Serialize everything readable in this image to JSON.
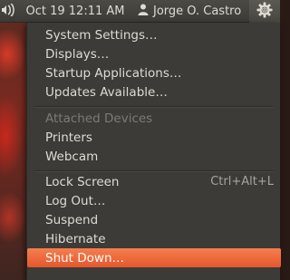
{
  "panel": {
    "sound_icon": "speaker-icon",
    "clock": "Oct 19 12:11 AM",
    "user_icon": "person-icon",
    "user_name": "Jorge O. Castro",
    "session_icon": "gear-power-icon"
  },
  "menu": {
    "system_settings": "System Settings…",
    "displays": "Displays…",
    "startup_applications": "Startup Applications…",
    "updates_available": "Updates Available…",
    "attached_devices_header": "Attached Devices",
    "printers": "Printers",
    "webcam": "Webcam",
    "lock_screen": "Lock Screen",
    "lock_screen_shortcut": "Ctrl+Alt+L",
    "log_out": "Log Out…",
    "suspend": "Suspend",
    "hibernate": "Hibernate",
    "shut_down": "Shut Down…"
  },
  "colors": {
    "panel_bg": "#3c3b37",
    "menu_bg": "#3c3b37",
    "menu_text": "#dfdbd2",
    "header_text": "#7d7a74",
    "highlight": "#e6572b"
  }
}
